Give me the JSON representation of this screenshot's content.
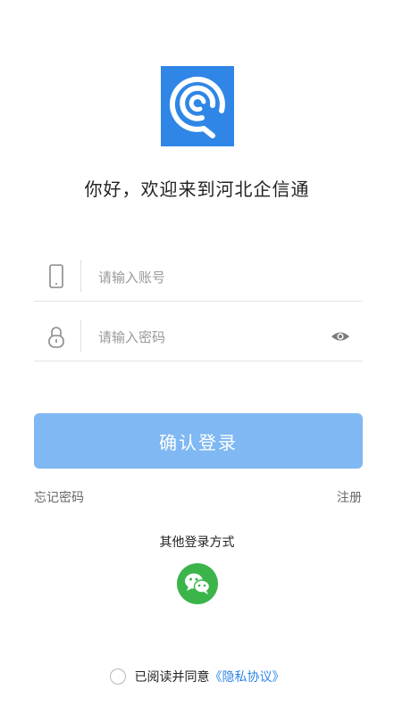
{
  "welcome": "你好，欢迎来到河北企信通",
  "form": {
    "account_placeholder": "请输入账号",
    "password_placeholder": "请输入密码"
  },
  "actions": {
    "login_label": "确认登录",
    "forgot_label": "忘记密码",
    "register_label": "注册"
  },
  "other_login": {
    "title": "其他登录方式"
  },
  "agreement": {
    "prefix": "已阅读并同意",
    "policy_link": "《隐私协议》"
  },
  "colors": {
    "brand": "#2f86e6",
    "button": "#7fb8f2",
    "wechat": "#3bb54a"
  },
  "icons": {
    "logo": "brand-logo-icon",
    "account": "phone-icon",
    "password": "lock-icon",
    "visibility": "eye-icon",
    "wechat": "wechat-icon"
  }
}
